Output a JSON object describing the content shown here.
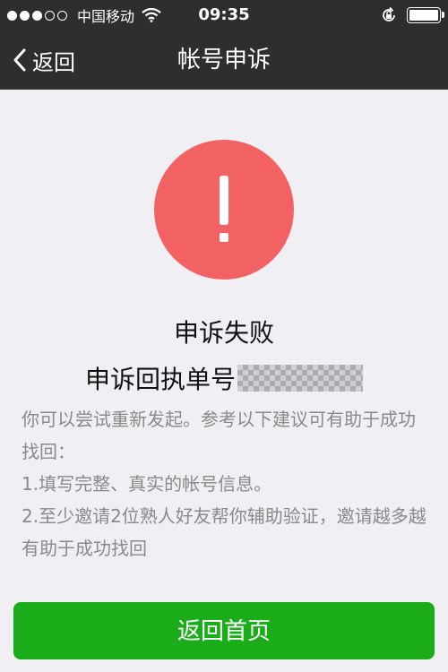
{
  "status_bar": {
    "carrier": "中国移动",
    "time": "09:35"
  },
  "nav": {
    "back_label": "返回",
    "title": "帐号申诉"
  },
  "result": {
    "title": "申诉失败",
    "receipt_label": "申诉回执单号"
  },
  "suggestions": [
    "你可以尝试重新发起。参考以下建议可有助于成功找回：",
    "1.填写完整、真实的帐号信息。",
    "2.至少邀请2位熟人好友帮你辅助验证，邀请越多越有助于成功找回"
  ],
  "actions": {
    "home_label": "返回首页"
  },
  "colors": {
    "nav_bg": "#2e2e2e",
    "alert_red": "#f26262",
    "button_green": "#1aad19",
    "page_bg": "#efeff4"
  }
}
